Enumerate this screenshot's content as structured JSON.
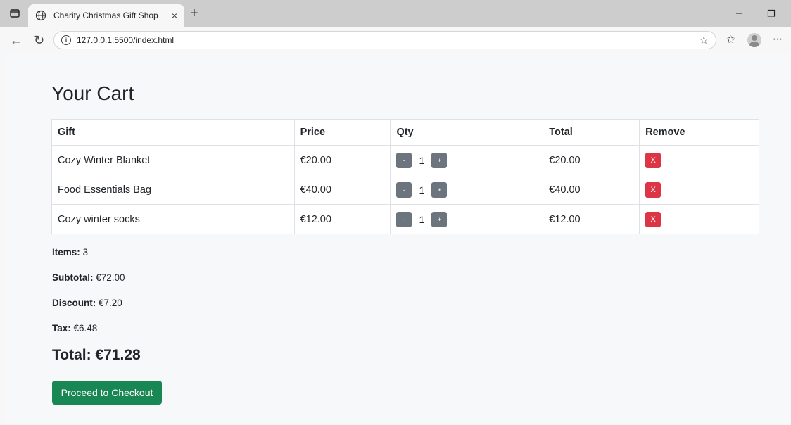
{
  "browser": {
    "tab_title": "Charity Christmas Gift Shop",
    "tab_close": "×",
    "new_tab": "+",
    "url": "127.0.0.1:5500/index.html",
    "minimize": "–",
    "restore": "❐",
    "more": "⋯"
  },
  "cart": {
    "title": "Your Cart",
    "headers": [
      "Gift",
      "Price",
      "Qty",
      "Total",
      "Remove"
    ],
    "rows": [
      {
        "gift": "Cozy Winter Blanket",
        "price": "€20.00",
        "qty": "1",
        "total": "€20.00",
        "dec": "-",
        "inc": "+",
        "remove": "X"
      },
      {
        "gift": "Food Essentials Bag",
        "price": "€40.00",
        "qty": "1",
        "total": "€40.00",
        "dec": "-",
        "inc": "+",
        "remove": "X"
      },
      {
        "gift": "Cozy winter socks",
        "price": "€12.00",
        "qty": "1",
        "total": "€12.00",
        "dec": "-",
        "inc": "+",
        "remove": "X"
      }
    ]
  },
  "summary": {
    "items_label": "Items:",
    "items_value": "3",
    "subtotal_label": "Subtotal:",
    "subtotal_value": "€72.00",
    "discount_label": "Discount:",
    "discount_value": "€7.20",
    "tax_label": "Tax:",
    "tax_value": "€6.48",
    "total_label": "Total:",
    "total_value": "€71.28"
  },
  "checkout_label": "Proceed to Checkout",
  "colors": {
    "checkout": "#198754",
    "remove": "#dc3545",
    "qty_button": "#6c757d"
  },
  "icons": [
    "sidebar-toggle-icon",
    "globe-icon",
    "close-icon",
    "back-arrow-icon",
    "refresh-icon",
    "info-icon",
    "star-icon",
    "favorites-icon",
    "profile-icon",
    "more-icon"
  ]
}
